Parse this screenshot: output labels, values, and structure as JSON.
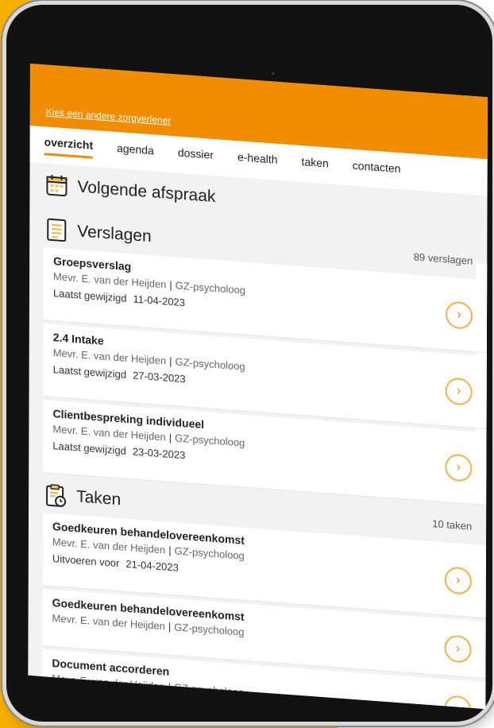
{
  "colors": {
    "accent": "#f7b000",
    "brand_orange": "#f28c00",
    "chevron_ring": "#f7b042"
  },
  "header": {
    "change_provider_link": "Kies een andere zorgverlener"
  },
  "tabs": [
    {
      "label": "overzicht",
      "active": true
    },
    {
      "label": "agenda"
    },
    {
      "label": "dossier"
    },
    {
      "label": "e-health"
    },
    {
      "label": "taken"
    },
    {
      "label": "contacten"
    }
  ],
  "next_appointment": {
    "title": "Volgende afspraak",
    "icon": "calendar-icon"
  },
  "reports": {
    "title": "Verslagen",
    "icon": "document-icon",
    "count": "89 verslagen",
    "items": [
      {
        "title": "Groepsverslag",
        "author": "Mevr. E. van der Heijden",
        "role": "GZ-psycholoog",
        "meta_label": "Laatst gewijzigd",
        "date": "11-04-2023"
      },
      {
        "title": "2.4 Intake",
        "author": "Mevr. E. van der Heijden",
        "role": "GZ-psycholoog",
        "meta_label": "Laatst gewijzigd",
        "date": "27-03-2023"
      },
      {
        "title": "Clientbespreking individueel",
        "author": "Mevr. E. van der Heijden",
        "role": "GZ-psycholoog",
        "meta_label": "Laatst gewijzigd",
        "date": "23-03-2023"
      }
    ]
  },
  "tasks": {
    "title": "Taken",
    "icon": "clipboard-clock-icon",
    "count": "10 taken",
    "items": [
      {
        "title": "Goedkeuren behandelovereenkomst",
        "author": "Mevr. E. van der Heijden",
        "role": "GZ-psycholoog",
        "meta_label": "Uitvoeren voor",
        "date": "21-04-2023"
      },
      {
        "title": "Goedkeuren behandelovereenkomst",
        "author": "Mevr. E. van der Heijden",
        "role": "GZ-psycholoog"
      },
      {
        "title": "Document accorderen",
        "author": "Mevr. E. van der Heijden",
        "role": "GZ-psycholoog"
      }
    ]
  }
}
